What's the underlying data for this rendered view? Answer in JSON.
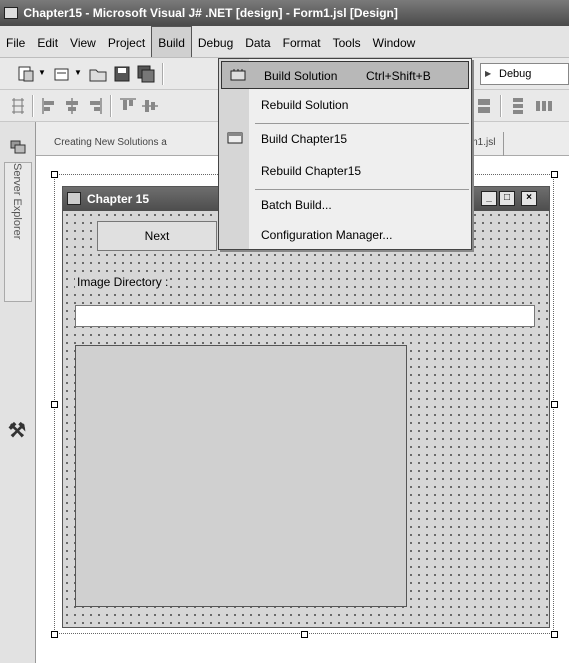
{
  "window": {
    "title": "Chapter15 - Microsoft Visual J# .NET [design] - Form1.jsl [Design]"
  },
  "menubar": {
    "items": [
      "File",
      "Edit",
      "View",
      "Project",
      "Build",
      "Debug",
      "Data",
      "Format",
      "Tools",
      "Window"
    ],
    "active": "Build"
  },
  "toolbar": {
    "config_value": "Debug"
  },
  "doc_tabs": {
    "tab1": "Creating New Solutions a",
    "tab2": "rm1.jsl"
  },
  "sidebar": {
    "server_explorer_label": "Server Explorer"
  },
  "build_menu": {
    "items": [
      {
        "label": "Build Solution",
        "shortcut": "Ctrl+Shift+B",
        "icon": "build-solution-icon",
        "highlighted": true
      },
      {
        "label": "Rebuild Solution",
        "shortcut": ""
      },
      {
        "label": "Build Chapter15",
        "shortcut": "",
        "icon": "build-project-icon"
      },
      {
        "label": "Rebuild Chapter15",
        "shortcut": ""
      },
      {
        "label": "Batch Build...",
        "shortcut": ""
      },
      {
        "label": "Configuration Manager...",
        "shortcut": ""
      }
    ]
  },
  "form": {
    "title": "Chapter 15",
    "next_button": "Next",
    "image_directory_label": "Image Directory :",
    "directory_value": "",
    "window_buttons": [
      "_",
      "□",
      "×"
    ]
  }
}
